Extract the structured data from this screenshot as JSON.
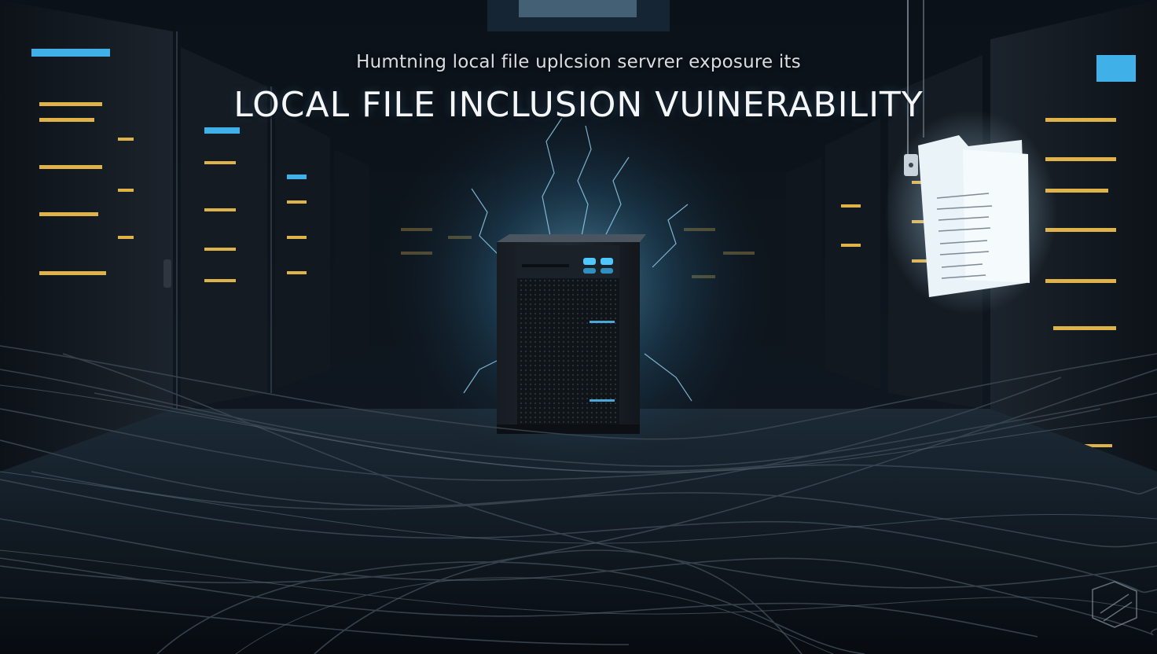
{
  "banner": {
    "subtitle": "Humtning local file uplcsion servrer exposure its",
    "title": "LOCAL FILE INCLUSION VUlNERABILITY"
  },
  "colors": {
    "background": "#06090d",
    "glow": "#7fd3ff",
    "server_led": "#4fc8ff",
    "rack_led_amber": "#e0b24a",
    "rack_led_blue": "#3fb0e8"
  }
}
